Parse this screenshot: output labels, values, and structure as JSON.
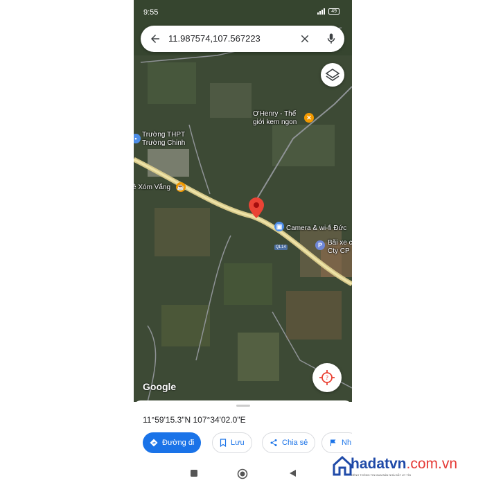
{
  "status_bar": {
    "time": "9:55",
    "battery": "49"
  },
  "search": {
    "query": "11.987574,107.567223"
  },
  "map": {
    "pois": [
      {
        "label_lines": [
          "O'Henry - Thế",
          "giới kem ngon"
        ],
        "icon": "fork-knife-icon",
        "color": "#f29900"
      },
      {
        "label_lines": [
          "Trường THPT",
          "Trường Chinh"
        ],
        "icon": "school-icon",
        "color": "#4e8ee8"
      },
      {
        "label_lines": [
          "ê Xóm Vắng"
        ],
        "icon": "cafe-icon",
        "color": "#f29900"
      },
      {
        "label_lines": [
          "Camera & wi-fi Đức"
        ],
        "icon": "shopping-bag-icon",
        "color": "#4e8ee8"
      },
      {
        "label_lines": [
          "Bãi xe c",
          "Cty CP"
        ],
        "icon": "parking-icon",
        "color": "#6f87d8",
        "glyph": "P"
      }
    ],
    "road_label": "QL14",
    "branding": "Google",
    "pin_color": "#ea4335"
  },
  "sheet": {
    "coordinates": "11°59'15.3\"N 107°34'02.0\"E",
    "actions": [
      {
        "label": "Đường đi",
        "icon": "directions-icon",
        "primary": true
      },
      {
        "label": "Lưu",
        "icon": "bookmark-icon",
        "primary": false
      },
      {
        "label": "Chia sẻ",
        "icon": "share-icon",
        "primary": false
      },
      {
        "label": "Nh",
        "icon": "flag-icon",
        "primary": false
      }
    ]
  },
  "watermark": {
    "name": "hadatvn",
    "domain": ".com.vn",
    "tagline": "KÊNH THÔNG TIN MUA BÁN NHÀ ĐẤT UY TÍN"
  },
  "colors": {
    "accent": "#1a73e8",
    "map_base": "#3d4a35"
  }
}
